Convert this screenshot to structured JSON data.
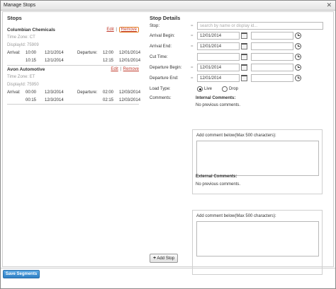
{
  "window": {
    "title": "Manage Stops",
    "close_glyph": "✕"
  },
  "stops": {
    "title": "Stops",
    "edit_label": "Edit",
    "remove_label": "Remove",
    "separator": "|",
    "items": [
      {
        "name": "Columbian Chemicals",
        "timezone": "Time Zone: CT",
        "display_id": "DisplayId: 75909",
        "arrival_label": "Arrival:",
        "departure_label": "Departure:",
        "rows": [
          {
            "arr_time": "10:00",
            "arr_date": "12/1/2014",
            "dep_time": "12:00",
            "dep_date": "12/01/2014"
          },
          {
            "arr_time": "10:15",
            "arr_date": "12/1/2014",
            "dep_time": "12:15",
            "dep_date": "12/01/2014"
          }
        ]
      },
      {
        "name": "Avon Automotive",
        "timezone": "Time Zone: ET",
        "display_id": "DisplayId: 75950",
        "arrival_label": "Arrival:",
        "departure_label": "Departure:",
        "rows": [
          {
            "arr_time": "00:00",
            "arr_date": "12/3/2014",
            "dep_time": "02:00",
            "dep_date": "12/03/2014"
          },
          {
            "arr_time": "00:15",
            "arr_date": "12/3/2014",
            "dep_time": "02:15",
            "dep_date": "12/03/2014"
          }
        ]
      }
    ]
  },
  "details": {
    "title": "Stop Details",
    "stop_label": "Stop:",
    "stop_placeholder": "search by name or display id...",
    "arrival_begin_label": "Arrival Begin:",
    "arrival_begin_date": "12/01/2014",
    "arrival_end_label": "Arrival End:",
    "arrival_end_date": "12/01/2014",
    "cut_time_label": "Cut Time:",
    "departure_begin_label": "Departure Begin:",
    "departure_begin_date": "12/01/2014",
    "departure_end_label": "Departure End:",
    "departure_end_date": "12/01/2014",
    "load_type_label": "Load Type:",
    "load_live": "Live",
    "load_drop": "Drop",
    "comments_label": "Comments:",
    "eq": "=",
    "internal_title": "Internal Comments:",
    "internal_text": "No previous comments.",
    "external_title": "External Comments:",
    "external_text": "No previous comments.",
    "add_comment_label": "Add comment below(Max 500 characters):",
    "add_stop_label": "Add Stop",
    "add_stop_glyph": "+"
  },
  "footer": {
    "save_label": "Save Segments"
  },
  "colors": {
    "accent": "#2f7fc4",
    "link": "#c0392b",
    "highlight": "#e67e22"
  }
}
